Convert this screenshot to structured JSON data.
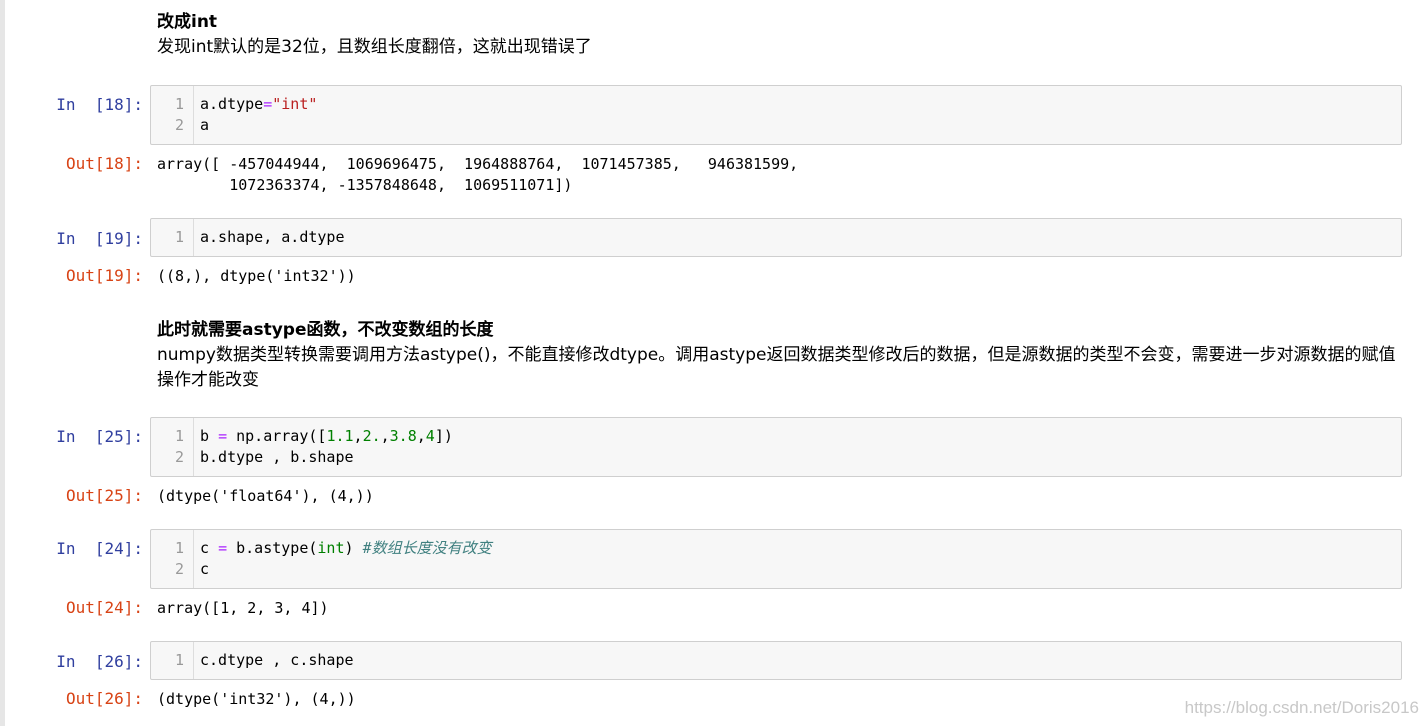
{
  "markdown1": {
    "heading": "改成int",
    "text": "发现int默认的是32位，且数组长度翻倍，这就出现错误了"
  },
  "markdown2": {
    "heading": "此时就需要astype函数，不改变数组的长度",
    "text": "numpy数据类型转换需要调用方法astype()，不能直接修改dtype。调用astype返回数据类型修改后的数据，但是源数据的类型不会变，需要进一步对源数据的赋值操作才能改变"
  },
  "cells": [
    {
      "in_prompt": "In  [18]:",
      "lines": [
        [
          {
            "t": "a.dtype",
            "k": ""
          },
          {
            "t": "=",
            "k": "o"
          },
          {
            "t": "\"int\"",
            "k": "s"
          }
        ],
        [
          {
            "t": "a",
            "k": ""
          }
        ]
      ],
      "out_prompt": "Out[18]:",
      "output": "array([ -457044944,  1069696475,  1964888764,  1071457385,   946381599,\n        1072363374, -1357848648,  1069511071])"
    },
    {
      "in_prompt": "In  [19]:",
      "lines": [
        [
          {
            "t": "a.shape, a.dtype",
            "k": ""
          }
        ]
      ],
      "out_prompt": "Out[19]:",
      "output": "((8,), dtype('int32'))"
    },
    {
      "in_prompt": "In  [25]:",
      "lines": [
        [
          {
            "t": "b ",
            "k": ""
          },
          {
            "t": "=",
            "k": "o"
          },
          {
            "t": " np.array([",
            "k": ""
          },
          {
            "t": "1.1",
            "k": "n"
          },
          {
            "t": ",",
            "k": ""
          },
          {
            "t": "2.",
            "k": "n"
          },
          {
            "t": ",",
            "k": ""
          },
          {
            "t": "3.8",
            "k": "n"
          },
          {
            "t": ",",
            "k": ""
          },
          {
            "t": "4",
            "k": "n"
          },
          {
            "t": "])",
            "k": ""
          }
        ],
        [
          {
            "t": "b.dtype , b.shape",
            "k": ""
          }
        ]
      ],
      "out_prompt": "Out[25]:",
      "output": "(dtype('float64'), (4,))"
    },
    {
      "in_prompt": "In  [24]:",
      "lines": [
        [
          {
            "t": "c ",
            "k": ""
          },
          {
            "t": "=",
            "k": "o"
          },
          {
            "t": " b.astype(",
            "k": ""
          },
          {
            "t": "int",
            "k": "n"
          },
          {
            "t": ") ",
            "k": ""
          },
          {
            "t": "#数组长度没有改变",
            "k": "c"
          }
        ],
        [
          {
            "t": "c",
            "k": ""
          }
        ]
      ],
      "out_prompt": "Out[24]:",
      "output": "array([1, 2, 3, 4])"
    },
    {
      "in_prompt": "In  [26]:",
      "lines": [
        [
          {
            "t": "c.dtype , c.shape",
            "k": ""
          }
        ]
      ],
      "out_prompt": "Out[26]:",
      "output": "(dtype('int32'), (4,))"
    }
  ],
  "watermark": "https://blog.csdn.net/Doris2016"
}
